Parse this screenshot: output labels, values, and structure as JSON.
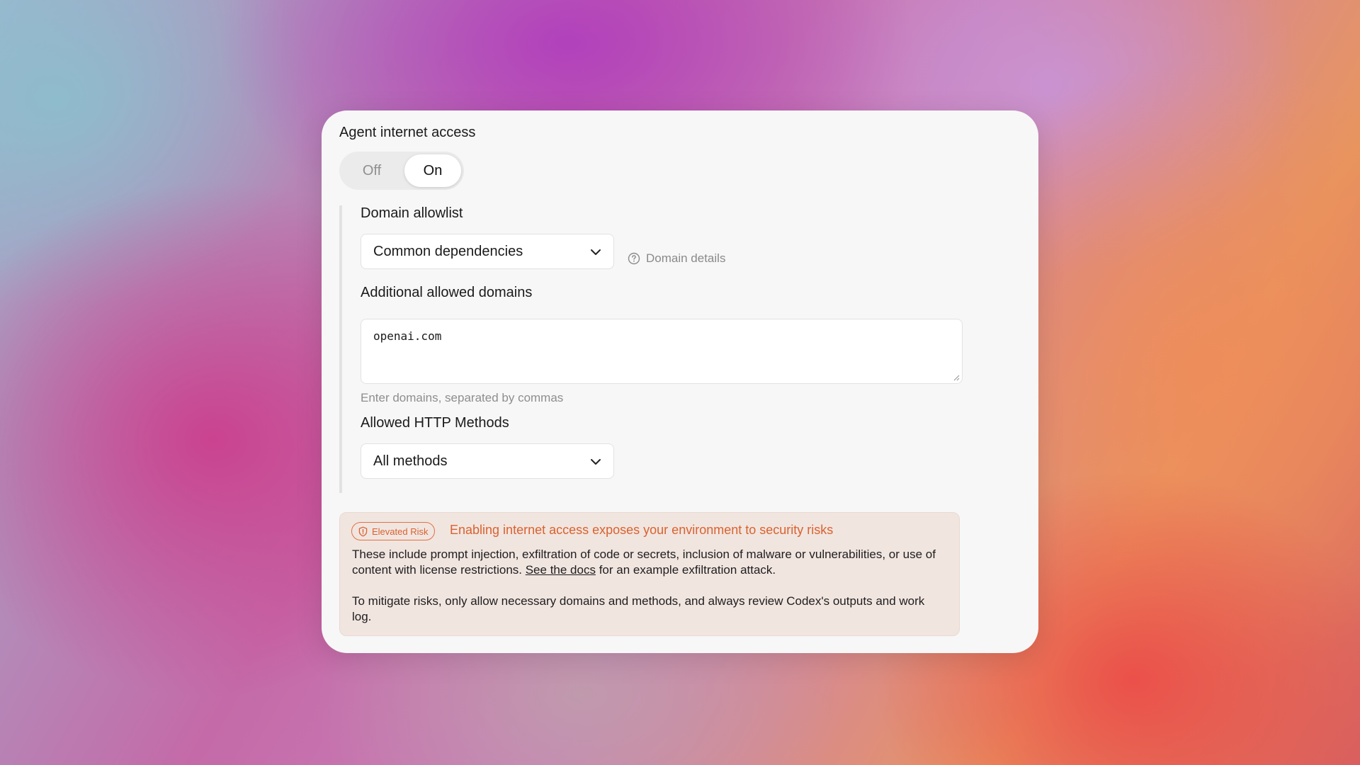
{
  "card": {
    "title": "Agent internet access",
    "toggle": {
      "off_label": "Off",
      "on_label": "On",
      "selected": "On"
    }
  },
  "allowlist": {
    "label": "Domain allowlist",
    "selected": "Common dependencies",
    "details_label": "Domain details"
  },
  "additional": {
    "label": "Additional allowed domains",
    "value": "openai.com",
    "hint": "Enter domains, separated by commas"
  },
  "methods": {
    "label": "Allowed HTTP Methods",
    "selected": "All methods"
  },
  "warning": {
    "badge": "Elevated Risk",
    "title": "Enabling internet access exposes your environment to security risks",
    "para1_before": "These include prompt injection, exfiltration of code or secrets, inclusion of malware or vulnerabilities, or use of content with license restrictions. ",
    "para1_link": "See the docs",
    "para1_after": " for an example exfiltration attack.",
    "para2": "To mitigate risks, only allow necessary domains and methods, and always review Codex's outputs and work log."
  },
  "colors": {
    "warning_accent": "#d9622e",
    "warning_bg": "#f1e5e0",
    "card_bg": "#f7f7f7"
  }
}
